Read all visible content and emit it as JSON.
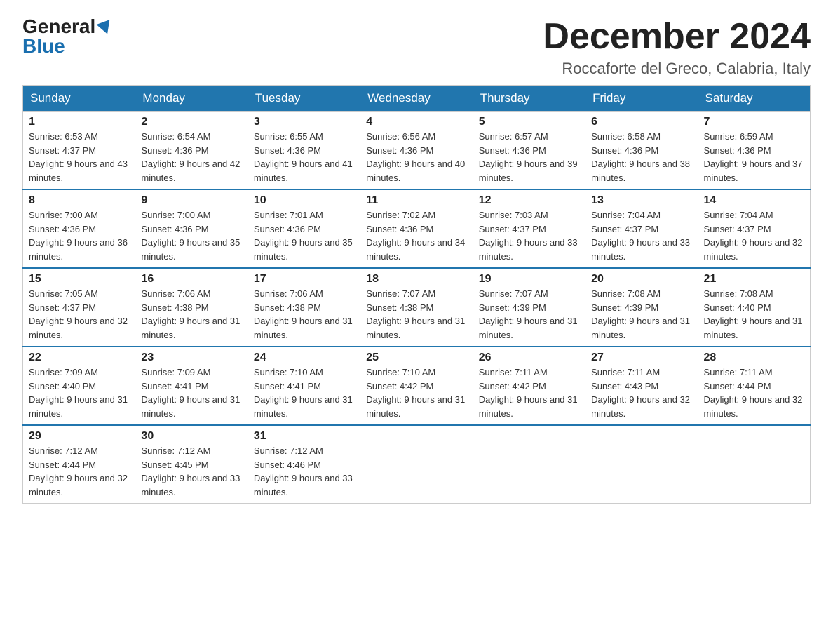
{
  "logo": {
    "general": "General",
    "blue": "Blue"
  },
  "header": {
    "month_year": "December 2024",
    "location": "Roccaforte del Greco, Calabria, Italy"
  },
  "days_of_week": [
    "Sunday",
    "Monday",
    "Tuesday",
    "Wednesday",
    "Thursday",
    "Friday",
    "Saturday"
  ],
  "weeks": [
    [
      {
        "day": "1",
        "sunrise": "Sunrise: 6:53 AM",
        "sunset": "Sunset: 4:37 PM",
        "daylight": "Daylight: 9 hours and 43 minutes."
      },
      {
        "day": "2",
        "sunrise": "Sunrise: 6:54 AM",
        "sunset": "Sunset: 4:36 PM",
        "daylight": "Daylight: 9 hours and 42 minutes."
      },
      {
        "day": "3",
        "sunrise": "Sunrise: 6:55 AM",
        "sunset": "Sunset: 4:36 PM",
        "daylight": "Daylight: 9 hours and 41 minutes."
      },
      {
        "day": "4",
        "sunrise": "Sunrise: 6:56 AM",
        "sunset": "Sunset: 4:36 PM",
        "daylight": "Daylight: 9 hours and 40 minutes."
      },
      {
        "day": "5",
        "sunrise": "Sunrise: 6:57 AM",
        "sunset": "Sunset: 4:36 PM",
        "daylight": "Daylight: 9 hours and 39 minutes."
      },
      {
        "day": "6",
        "sunrise": "Sunrise: 6:58 AM",
        "sunset": "Sunset: 4:36 PM",
        "daylight": "Daylight: 9 hours and 38 minutes."
      },
      {
        "day": "7",
        "sunrise": "Sunrise: 6:59 AM",
        "sunset": "Sunset: 4:36 PM",
        "daylight": "Daylight: 9 hours and 37 minutes."
      }
    ],
    [
      {
        "day": "8",
        "sunrise": "Sunrise: 7:00 AM",
        "sunset": "Sunset: 4:36 PM",
        "daylight": "Daylight: 9 hours and 36 minutes."
      },
      {
        "day": "9",
        "sunrise": "Sunrise: 7:00 AM",
        "sunset": "Sunset: 4:36 PM",
        "daylight": "Daylight: 9 hours and 35 minutes."
      },
      {
        "day": "10",
        "sunrise": "Sunrise: 7:01 AM",
        "sunset": "Sunset: 4:36 PM",
        "daylight": "Daylight: 9 hours and 35 minutes."
      },
      {
        "day": "11",
        "sunrise": "Sunrise: 7:02 AM",
        "sunset": "Sunset: 4:36 PM",
        "daylight": "Daylight: 9 hours and 34 minutes."
      },
      {
        "day": "12",
        "sunrise": "Sunrise: 7:03 AM",
        "sunset": "Sunset: 4:37 PM",
        "daylight": "Daylight: 9 hours and 33 minutes."
      },
      {
        "day": "13",
        "sunrise": "Sunrise: 7:04 AM",
        "sunset": "Sunset: 4:37 PM",
        "daylight": "Daylight: 9 hours and 33 minutes."
      },
      {
        "day": "14",
        "sunrise": "Sunrise: 7:04 AM",
        "sunset": "Sunset: 4:37 PM",
        "daylight": "Daylight: 9 hours and 32 minutes."
      }
    ],
    [
      {
        "day": "15",
        "sunrise": "Sunrise: 7:05 AM",
        "sunset": "Sunset: 4:37 PM",
        "daylight": "Daylight: 9 hours and 32 minutes."
      },
      {
        "day": "16",
        "sunrise": "Sunrise: 7:06 AM",
        "sunset": "Sunset: 4:38 PM",
        "daylight": "Daylight: 9 hours and 31 minutes."
      },
      {
        "day": "17",
        "sunrise": "Sunrise: 7:06 AM",
        "sunset": "Sunset: 4:38 PM",
        "daylight": "Daylight: 9 hours and 31 minutes."
      },
      {
        "day": "18",
        "sunrise": "Sunrise: 7:07 AM",
        "sunset": "Sunset: 4:38 PM",
        "daylight": "Daylight: 9 hours and 31 minutes."
      },
      {
        "day": "19",
        "sunrise": "Sunrise: 7:07 AM",
        "sunset": "Sunset: 4:39 PM",
        "daylight": "Daylight: 9 hours and 31 minutes."
      },
      {
        "day": "20",
        "sunrise": "Sunrise: 7:08 AM",
        "sunset": "Sunset: 4:39 PM",
        "daylight": "Daylight: 9 hours and 31 minutes."
      },
      {
        "day": "21",
        "sunrise": "Sunrise: 7:08 AM",
        "sunset": "Sunset: 4:40 PM",
        "daylight": "Daylight: 9 hours and 31 minutes."
      }
    ],
    [
      {
        "day": "22",
        "sunrise": "Sunrise: 7:09 AM",
        "sunset": "Sunset: 4:40 PM",
        "daylight": "Daylight: 9 hours and 31 minutes."
      },
      {
        "day": "23",
        "sunrise": "Sunrise: 7:09 AM",
        "sunset": "Sunset: 4:41 PM",
        "daylight": "Daylight: 9 hours and 31 minutes."
      },
      {
        "day": "24",
        "sunrise": "Sunrise: 7:10 AM",
        "sunset": "Sunset: 4:41 PM",
        "daylight": "Daylight: 9 hours and 31 minutes."
      },
      {
        "day": "25",
        "sunrise": "Sunrise: 7:10 AM",
        "sunset": "Sunset: 4:42 PM",
        "daylight": "Daylight: 9 hours and 31 minutes."
      },
      {
        "day": "26",
        "sunrise": "Sunrise: 7:11 AM",
        "sunset": "Sunset: 4:42 PM",
        "daylight": "Daylight: 9 hours and 31 minutes."
      },
      {
        "day": "27",
        "sunrise": "Sunrise: 7:11 AM",
        "sunset": "Sunset: 4:43 PM",
        "daylight": "Daylight: 9 hours and 32 minutes."
      },
      {
        "day": "28",
        "sunrise": "Sunrise: 7:11 AM",
        "sunset": "Sunset: 4:44 PM",
        "daylight": "Daylight: 9 hours and 32 minutes."
      }
    ],
    [
      {
        "day": "29",
        "sunrise": "Sunrise: 7:12 AM",
        "sunset": "Sunset: 4:44 PM",
        "daylight": "Daylight: 9 hours and 32 minutes."
      },
      {
        "day": "30",
        "sunrise": "Sunrise: 7:12 AM",
        "sunset": "Sunset: 4:45 PM",
        "daylight": "Daylight: 9 hours and 33 minutes."
      },
      {
        "day": "31",
        "sunrise": "Sunrise: 7:12 AM",
        "sunset": "Sunset: 4:46 PM",
        "daylight": "Daylight: 9 hours and 33 minutes."
      },
      null,
      null,
      null,
      null
    ]
  ]
}
